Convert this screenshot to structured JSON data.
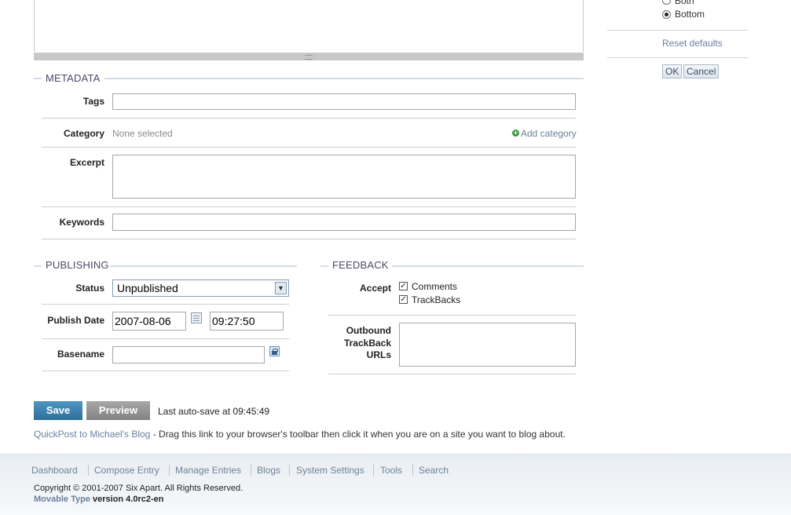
{
  "right_panel": {
    "radio_both_label": "Both",
    "radio_bottom_label": "Bottom",
    "reset_defaults": "Reset defaults",
    "ok_label": "OK",
    "cancel_label": "Cancel"
  },
  "metadata": {
    "title": "METADATA",
    "tags_label": "Tags",
    "tags_value": "",
    "category_label": "Category",
    "category_value": "None selected",
    "add_category": "Add category",
    "excerpt_label": "Excerpt",
    "excerpt_value": "",
    "keywords_label": "Keywords",
    "keywords_value": ""
  },
  "publishing": {
    "title": "PUBLISHING",
    "status_label": "Status",
    "status_value": "Unpublished",
    "publish_date_label": "Publish Date",
    "date_value": "2007-08-06",
    "time_value": "09:27:50",
    "basename_label": "Basename",
    "basename_value": ""
  },
  "feedback": {
    "title": "FEEDBACK",
    "accept_label": "Accept",
    "comments_label": "Comments",
    "comments_checked": true,
    "trackbacks_label": "TrackBacks",
    "trackbacks_checked": true,
    "outbound_label_1": "Outbound",
    "outbound_label_2": "TrackBack",
    "outbound_label_3": "URLs",
    "outbound_value": ""
  },
  "actions": {
    "save_label": "Save",
    "preview_label": "Preview",
    "autosave_text": "Last auto-save at 09:45:49"
  },
  "quickpost": {
    "link_text": "QuickPost to Michael's Blog",
    "description": " - Drag this link to your browser's toolbar then click it when you are on a site you want to blog about."
  },
  "footer": {
    "nav": [
      "Dashboard",
      "Compose Entry",
      "Manage Entries",
      "Blogs",
      "System Settings",
      "Tools",
      "Search"
    ],
    "copyright": "Copyright © 2001-2007 Six Apart. All Rights Reserved.",
    "product_name": "Movable Type",
    "version": " version 4.0rc2-en"
  },
  "colors": {
    "save_button": "#2b6f9a",
    "preview_button": "#8c8c8c",
    "section_heading": "#4a4a6a",
    "link": "#6b7fa0",
    "add_icon": "#3a9a3a"
  }
}
